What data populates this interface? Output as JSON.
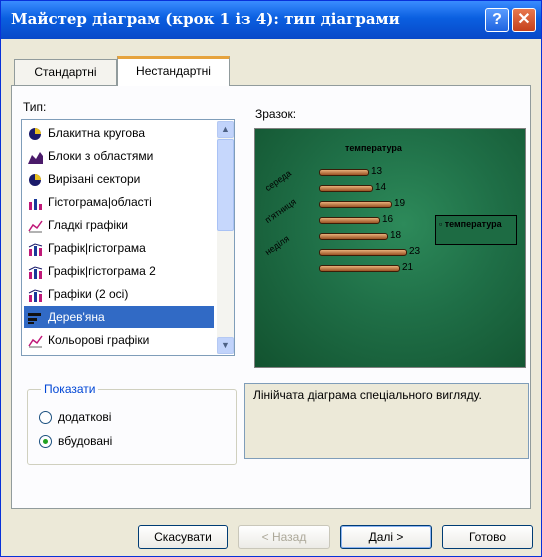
{
  "window": {
    "title": "Майстер діаграм (крок 1 із 4): тип діаграми",
    "help": "?",
    "close": "✕"
  },
  "tabs": [
    {
      "label": "Стандартні"
    },
    {
      "label": "Нестандартні"
    }
  ],
  "type_label": "Тип:",
  "sample_label": "Зразок:",
  "list": [
    {
      "label": "Блакитна кругова",
      "icon": "pie-chart-icon"
    },
    {
      "label": "Блоки з областями",
      "icon": "area-blocks-icon"
    },
    {
      "label": "Вирізані сектори",
      "icon": "pie-chart-icon"
    },
    {
      "label": "Гістограма|області",
      "icon": "histogram-area-icon"
    },
    {
      "label": "Гладкі графіки",
      "icon": "line-chart-icon"
    },
    {
      "label": "Графік|гістограма",
      "icon": "histogram-line-icon"
    },
    {
      "label": "Графік|гістограма 2",
      "icon": "histogram-line-icon"
    },
    {
      "label": "Графіки (2 осі)",
      "icon": "histogram-line-icon"
    },
    {
      "label": "Дерев'яна",
      "icon": "bar-chart-icon",
      "selected": true
    },
    {
      "label": "Кольорові графіки",
      "icon": "line-chart-icon"
    }
  ],
  "chart_data": {
    "type": "bar",
    "title": "температура",
    "values": [
      13,
      14,
      19,
      16,
      18,
      23,
      21
    ],
    "categories": [
      "середа",
      "",
      "п'ятниця",
      "",
      "неділя",
      "",
      ""
    ],
    "legend": "температура",
    "xlim": [
      0,
      25
    ],
    "colors": {
      "bar": "#b06a34",
      "background": "#1f6f47"
    }
  },
  "description": "Лінійчата діаграма спеціального вигляду.",
  "show_group": {
    "title": "Показати",
    "options": [
      {
        "label": "додаткові",
        "checked": false
      },
      {
        "label": "вбудовані",
        "checked": true
      }
    ]
  },
  "buttons": {
    "cancel": "Скасувати",
    "back": "< Назад",
    "next": "Далі >",
    "finish": "Готово"
  }
}
